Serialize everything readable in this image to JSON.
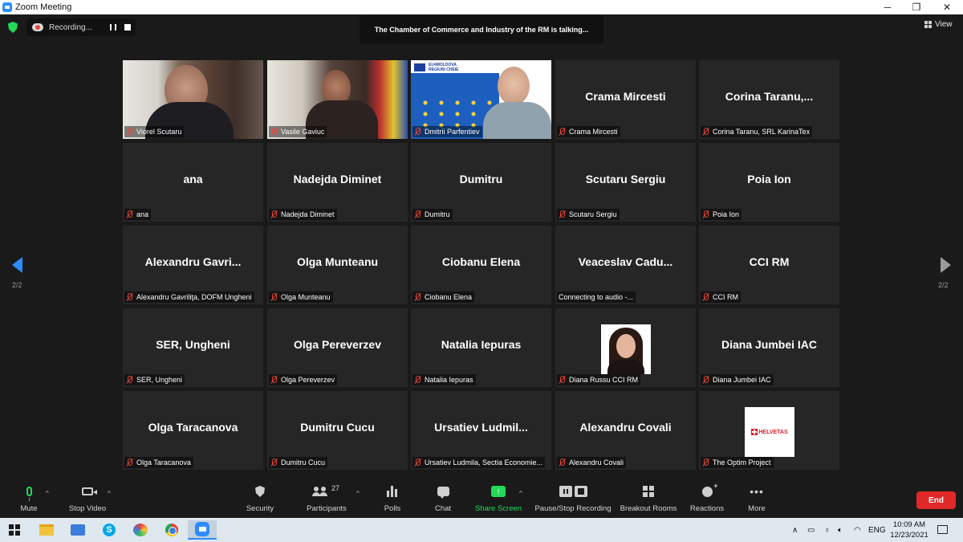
{
  "window": {
    "title": "Zoom Meeting",
    "minimize": "─",
    "restore": "❐",
    "close": "✕"
  },
  "topbar": {
    "recording_label": "Recording...",
    "speaker_banner": "The Chamber of Commerce and Industry of the RM is talking...",
    "view_label": "View"
  },
  "gallery": {
    "rows": [
      [
        {
          "kind": "video1",
          "big": "",
          "label": "Viorel Scutaru",
          "muted": true
        },
        {
          "kind": "video2",
          "big": "",
          "label": "Vasile Gaviuc",
          "muted": true
        },
        {
          "kind": "video3",
          "big": "",
          "label": "Dmitrii Parfentiev",
          "muted": true
        },
        {
          "kind": "name",
          "big": "Crama Mircesti",
          "label": "Crama Mircesti",
          "muted": true
        },
        {
          "kind": "name",
          "big": "Corina  Taranu,...",
          "label": "Corina Taranu, SRL KarinaTex",
          "muted": true
        }
      ],
      [
        {
          "kind": "name",
          "big": "ana",
          "label": "ana",
          "muted": true
        },
        {
          "kind": "name",
          "big": "Nadejda Diminet",
          "label": "Nadejda Diminet",
          "muted": true
        },
        {
          "kind": "name",
          "big": "Dumitru",
          "label": "Dumitru",
          "muted": true
        },
        {
          "kind": "name",
          "big": "Scutaru Sergiu",
          "label": "Scutaru Sergiu",
          "muted": true
        },
        {
          "kind": "name",
          "big": "Poia Ion",
          "label": "Poia Ion",
          "muted": true
        }
      ],
      [
        {
          "kind": "name",
          "big": "Alexandru  Gavri...",
          "label": "Alexandru Gavriliţa, DOFM Ungheni",
          "muted": true
        },
        {
          "kind": "name",
          "big": "Olga Munteanu",
          "label": "Olga Munteanu",
          "muted": true
        },
        {
          "kind": "name",
          "big": "Ciobanu Elena",
          "label": "Ciobanu Elena",
          "muted": true
        },
        {
          "kind": "name",
          "big": "Veaceslav  Cadu...",
          "label": "Connecting to audio -...",
          "muted": false
        },
        {
          "kind": "name",
          "big": "CCI RM",
          "label": "CCI RM",
          "muted": true
        }
      ],
      [
        {
          "kind": "name",
          "big": "SER, Ungheni",
          "label": "SER, Ungheni",
          "muted": true
        },
        {
          "kind": "name",
          "big": "Olga Pereverzev",
          "label": "Olga Pereverzev",
          "muted": true
        },
        {
          "kind": "name",
          "big": "Natalia Iepuras",
          "label": "Natalia Iepuras",
          "muted": true
        },
        {
          "kind": "portrait",
          "big": "",
          "label": "Diana Russu CCI RM",
          "muted": true
        },
        {
          "kind": "name",
          "big": "Diana Jumbei IAC",
          "label": "Diana Jumbei IAC",
          "muted": true
        }
      ],
      [
        {
          "kind": "name",
          "big": "Olga Taracanova",
          "label": "Olga Taracanova",
          "muted": true
        },
        {
          "kind": "name",
          "big": "Dumitru Cucu",
          "label": "Dumitru Cucu",
          "muted": true
        },
        {
          "kind": "name",
          "big": "Ursatiev  Ludmil...",
          "label": "Ursatiev Ludmila, Sectia Economie...",
          "muted": true
        },
        {
          "kind": "name",
          "big": "Alexandru Covali",
          "label": "Alexandru Covali",
          "muted": true
        },
        {
          "kind": "logo",
          "big": "",
          "label": "The Optim Project",
          "muted": true
        }
      ]
    ],
    "video3_texts": {
      "line1": "EU4MOLDOVA",
      "line2": "REGIUNI CHEIE"
    },
    "logo_text": "HELVETAS",
    "page_left": "2/2",
    "page_right": "2/2"
  },
  "toolbar": {
    "mute": "Mute",
    "stop_video": "Stop Video",
    "security": "Security",
    "participants": "Participants",
    "participants_count": "27",
    "polls": "Polls",
    "chat": "Chat",
    "share_screen": "Share Screen",
    "pause_stop_recording": "Pause/Stop Recording",
    "breakout_rooms": "Breakout Rooms",
    "reactions": "Reactions",
    "more": "More",
    "end": "End",
    "share_color": "#23d959",
    "end_color": "#e02828"
  },
  "taskbar": {
    "language": "ENG",
    "time": "10:09 AM",
    "date": "12/23/2021"
  }
}
